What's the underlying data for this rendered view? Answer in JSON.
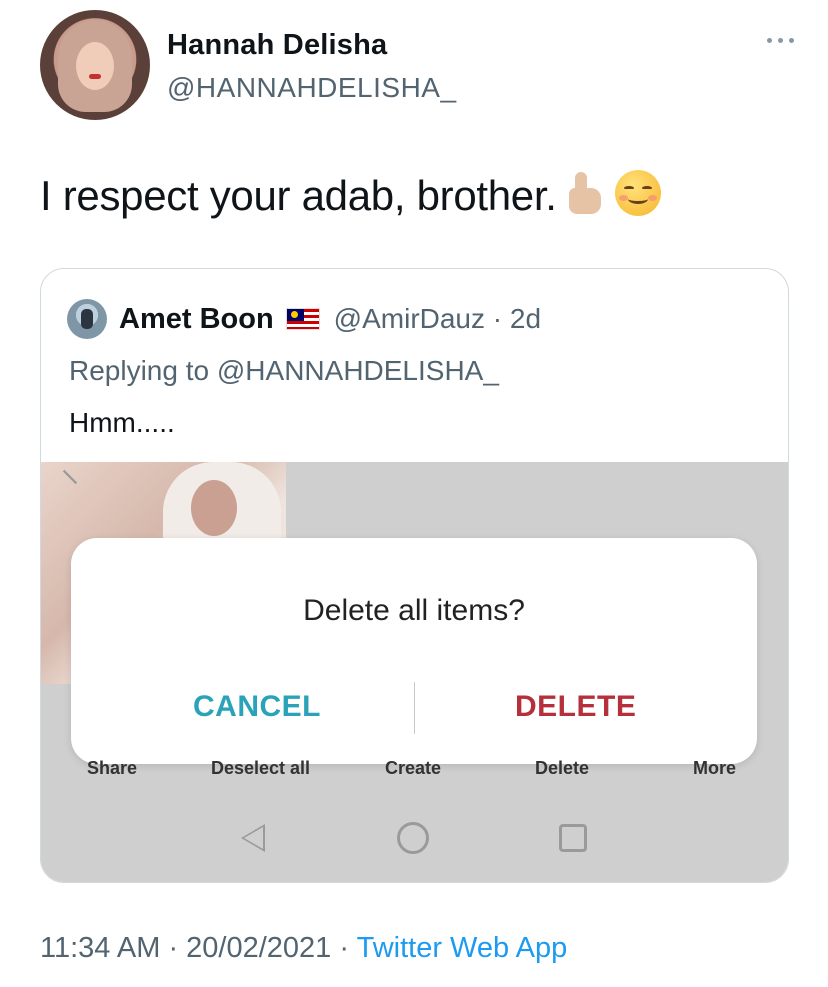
{
  "author": {
    "name": "Hannah Delisha",
    "handle": "@HANNAHDELISHA_"
  },
  "tweet": {
    "text": "I respect your adab, brother.",
    "emojis": [
      "thumbs-up-icon",
      "smiling-face-icon"
    ]
  },
  "quoted": {
    "name": "Amet Boon",
    "flag": "malaysia-flag-icon",
    "handle_time": "@AmirDauz · 2d",
    "replying_prefix": "Replying to ",
    "replying_handle": "@HANNAHDELISHA_",
    "text": "Hmm.....",
    "media": {
      "dialog_title": "Delete all items?",
      "cancel_label": "CANCEL",
      "delete_label": "DELETE",
      "cancel_color": "#2aa3b8",
      "delete_color": "#b5303a",
      "action_bar": [
        "Share",
        "Deselect all",
        "Create",
        "Delete",
        "More"
      ]
    }
  },
  "footer": {
    "time": "11:34 AM",
    "date": "20/02/2021",
    "separator": " · ",
    "source": "Twitter Web App"
  },
  "colors": {
    "secondary_text": "#536471",
    "link": "#1d9bf0",
    "border": "#cfd9de"
  }
}
